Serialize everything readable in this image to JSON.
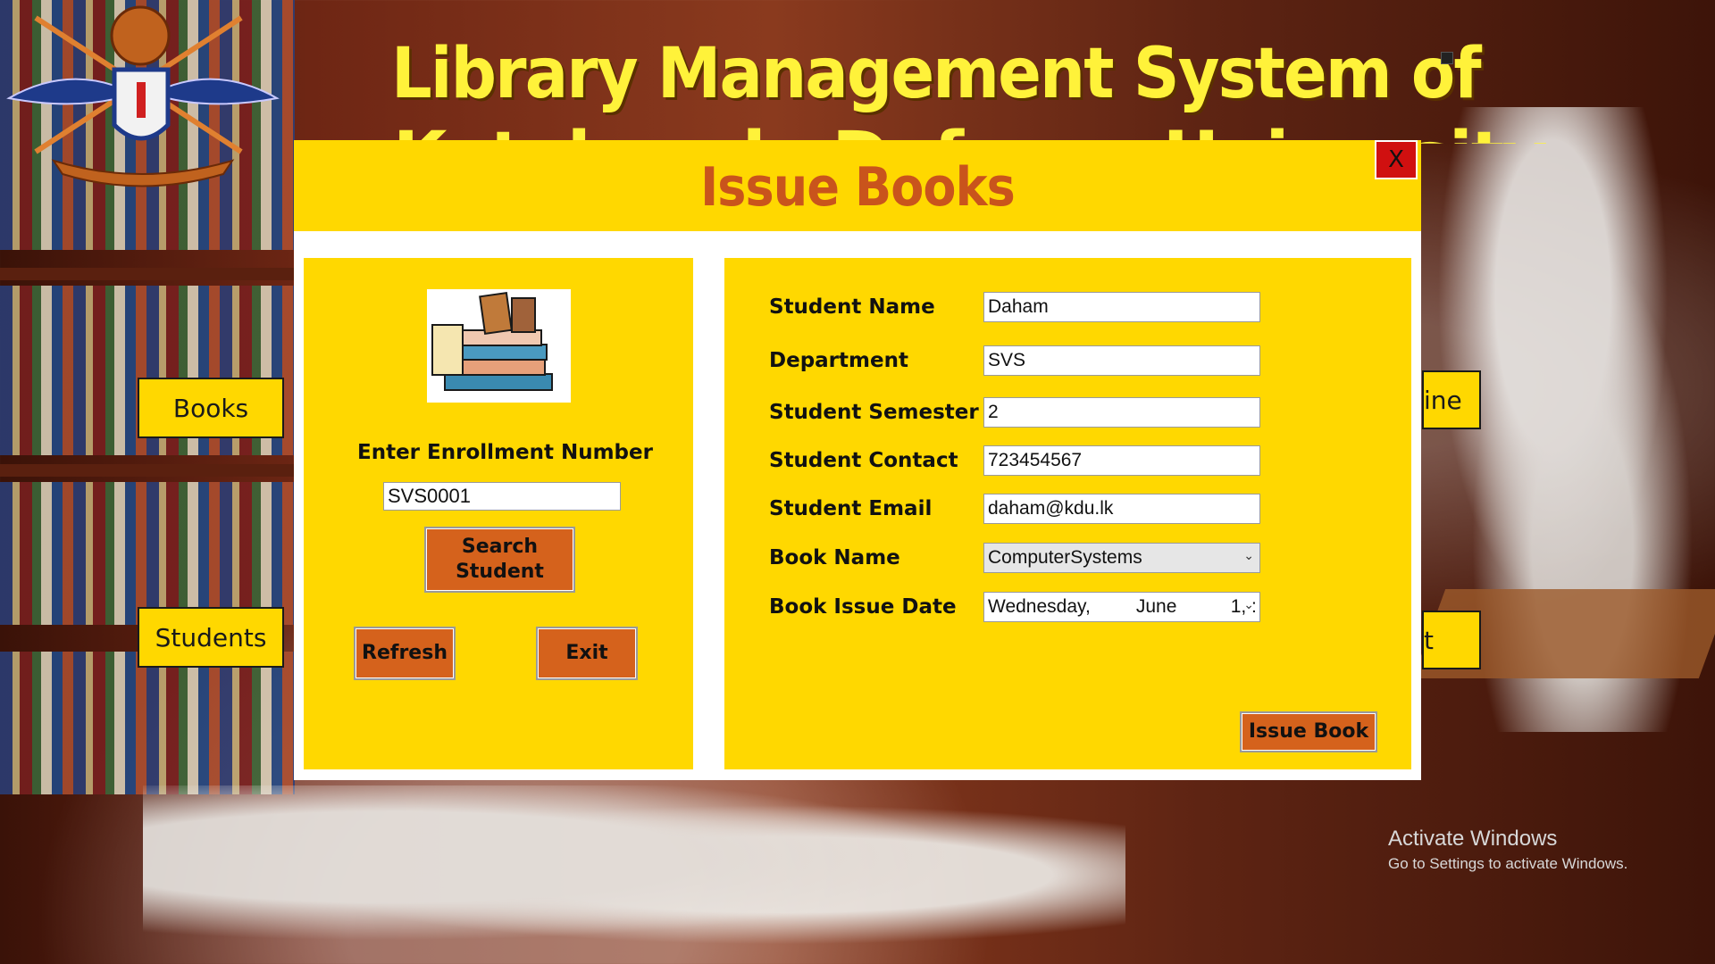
{
  "app": {
    "title": "Library Management System of",
    "title_line2": "Kotelawala Defence University"
  },
  "side_buttons": {
    "books": "Books",
    "students": "Students",
    "fine_partial": "ine",
    "right2_partial": "t"
  },
  "dialog": {
    "title": "Issue Books",
    "close_label": "X",
    "left": {
      "enroll_label": "Enter Enrollment Number",
      "enroll_value": "SVS0001",
      "search_label": "Search Student",
      "refresh_label": "Refresh",
      "exit_label": "Exit",
      "image_icon": "books-stack-icon"
    },
    "form": {
      "fields": [
        {
          "label": "Student Name",
          "value": "Daham"
        },
        {
          "label": "Department",
          "value": "SVS"
        },
        {
          "label": "Student Semester",
          "value": "2"
        },
        {
          "label": "Student Contact",
          "value": "723454567"
        },
        {
          "label": "Student Email",
          "value": "daham@kdu.lk"
        }
      ],
      "book_name_label": "Book Name",
      "book_name_value": "ComputerSystems",
      "issue_date_label": "Book Issue Date",
      "issue_date_day": "Wednesday,",
      "issue_date_month": "June",
      "issue_date_rest": "1, :",
      "issue_button": "Issue Book"
    }
  },
  "os": {
    "activate_title": "Activate Windows",
    "activate_sub": "Go to Settings to activate Windows."
  },
  "colors": {
    "panel_yellow": "#ffd800",
    "title_orange": "#c9541c",
    "button_orange": "#d5621c",
    "close_red": "#d01010",
    "title_yellow": "#fff23a"
  }
}
